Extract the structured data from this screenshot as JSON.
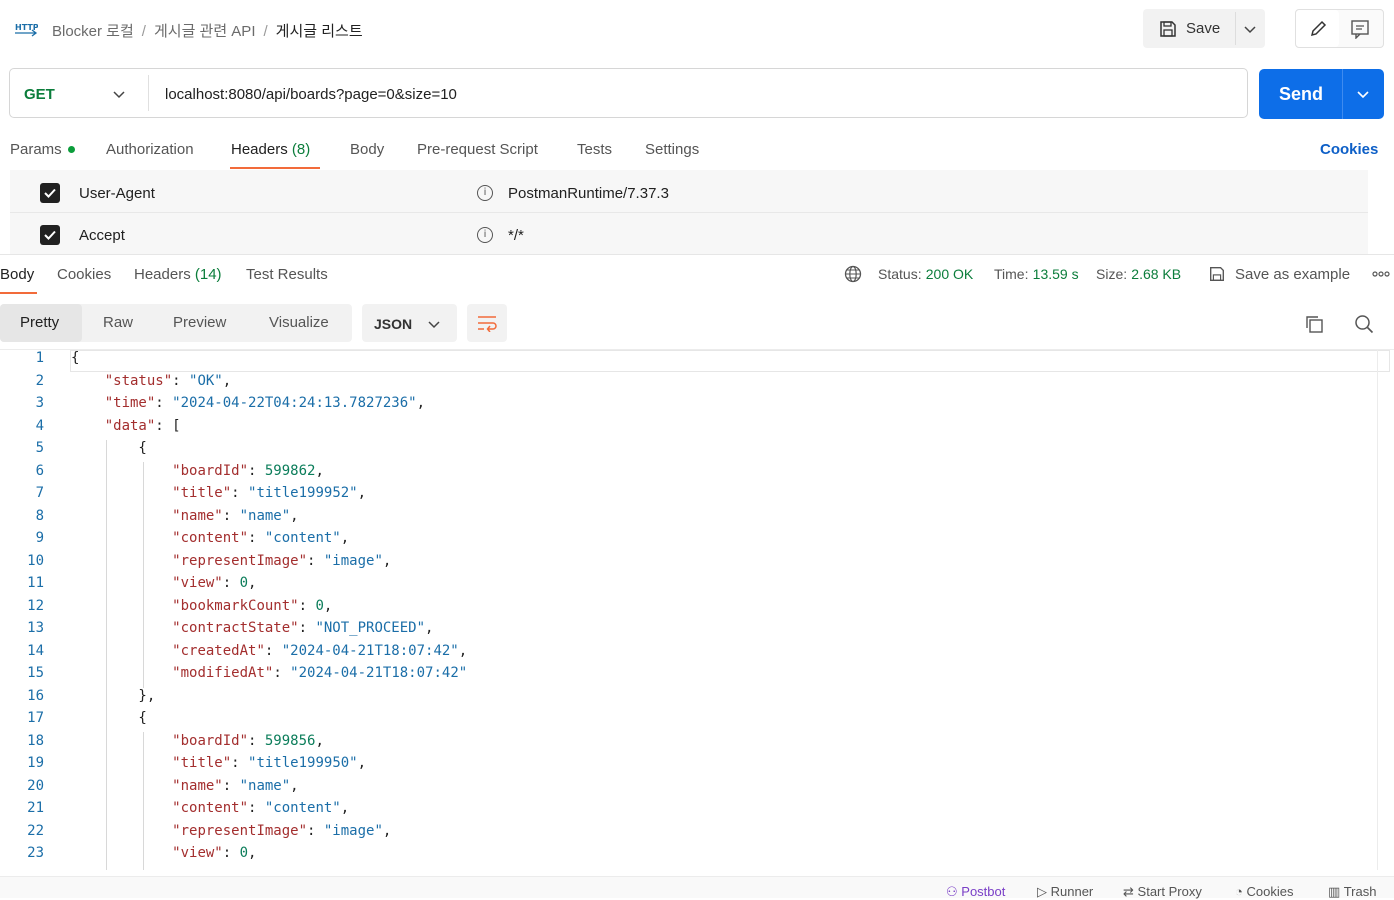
{
  "breadcrumb": {
    "icon": "http-icon",
    "workspace": "Blocker 로컬",
    "folder": "게시글 관련 API",
    "current": "게시글 리스트"
  },
  "header_actions": {
    "save_label": "Save"
  },
  "request": {
    "method": "GET",
    "url": "localhost:8080/api/boards?page=0&size=10",
    "send_label": "Send"
  },
  "request_tabs": {
    "params": "Params",
    "authorization": "Authorization",
    "headers": "Headers",
    "headers_count": "(8)",
    "body": "Body",
    "prerequest": "Pre-request Script",
    "tests": "Tests",
    "settings": "Settings",
    "cookies": "Cookies"
  },
  "headers_rows": [
    {
      "key": "User-Agent",
      "value": "PostmanRuntime/7.37.3"
    },
    {
      "key": "Accept",
      "value": "*/*"
    }
  ],
  "response_tabs": {
    "body": "Body",
    "cookies": "Cookies",
    "headers": "Headers",
    "headers_count": "(14)",
    "test_results": "Test Results"
  },
  "response_meta": {
    "status_label": "Status:",
    "status_value": "200 OK",
    "time_label": "Time:",
    "time_value": "13.59 s",
    "size_label": "Size:",
    "size_value": "2.68 KB",
    "save_example": "Save as example"
  },
  "view_modes": {
    "pretty": "Pretty",
    "raw": "Raw",
    "preview": "Preview",
    "visualize": "Visualize",
    "format": "JSON"
  },
  "code": {
    "lines": [
      [
        [
          "p",
          "{"
        ]
      ],
      [
        [
          "p",
          "    "
        ],
        [
          "k",
          "\"status\""
        ],
        [
          "p",
          ": "
        ],
        [
          "s",
          "\"OK\""
        ],
        [
          "p",
          ","
        ]
      ],
      [
        [
          "p",
          "    "
        ],
        [
          "k",
          "\"time\""
        ],
        [
          "p",
          ": "
        ],
        [
          "s",
          "\"2024-04-22T04:24:13.7827236\""
        ],
        [
          "p",
          ","
        ]
      ],
      [
        [
          "p",
          "    "
        ],
        [
          "k",
          "\"data\""
        ],
        [
          "p",
          ": ["
        ]
      ],
      [
        [
          "p",
          "        {"
        ]
      ],
      [
        [
          "p",
          "            "
        ],
        [
          "k",
          "\"boardId\""
        ],
        [
          "p",
          ": "
        ],
        [
          "n",
          "599862"
        ],
        [
          "p",
          ","
        ]
      ],
      [
        [
          "p",
          "            "
        ],
        [
          "k",
          "\"title\""
        ],
        [
          "p",
          ": "
        ],
        [
          "s",
          "\"title199952\""
        ],
        [
          "p",
          ","
        ]
      ],
      [
        [
          "p",
          "            "
        ],
        [
          "k",
          "\"name\""
        ],
        [
          "p",
          ": "
        ],
        [
          "s",
          "\"name\""
        ],
        [
          "p",
          ","
        ]
      ],
      [
        [
          "p",
          "            "
        ],
        [
          "k",
          "\"content\""
        ],
        [
          "p",
          ": "
        ],
        [
          "s",
          "\"content\""
        ],
        [
          "p",
          ","
        ]
      ],
      [
        [
          "p",
          "            "
        ],
        [
          "k",
          "\"representImage\""
        ],
        [
          "p",
          ": "
        ],
        [
          "s",
          "\"image\""
        ],
        [
          "p",
          ","
        ]
      ],
      [
        [
          "p",
          "            "
        ],
        [
          "k",
          "\"view\""
        ],
        [
          "p",
          ": "
        ],
        [
          "n",
          "0"
        ],
        [
          "p",
          ","
        ]
      ],
      [
        [
          "p",
          "            "
        ],
        [
          "k",
          "\"bookmarkCount\""
        ],
        [
          "p",
          ": "
        ],
        [
          "n",
          "0"
        ],
        [
          "p",
          ","
        ]
      ],
      [
        [
          "p",
          "            "
        ],
        [
          "k",
          "\"contractState\""
        ],
        [
          "p",
          ": "
        ],
        [
          "s",
          "\"NOT_PROCEED\""
        ],
        [
          "p",
          ","
        ]
      ],
      [
        [
          "p",
          "            "
        ],
        [
          "k",
          "\"createdAt\""
        ],
        [
          "p",
          ": "
        ],
        [
          "s",
          "\"2024-04-21T18:07:42\""
        ],
        [
          "p",
          ","
        ]
      ],
      [
        [
          "p",
          "            "
        ],
        [
          "k",
          "\"modifiedAt\""
        ],
        [
          "p",
          ": "
        ],
        [
          "s",
          "\"2024-04-21T18:07:42\""
        ]
      ],
      [
        [
          "p",
          "        },"
        ]
      ],
      [
        [
          "p",
          "        {"
        ]
      ],
      [
        [
          "p",
          "            "
        ],
        [
          "k",
          "\"boardId\""
        ],
        [
          "p",
          ": "
        ],
        [
          "n",
          "599856"
        ],
        [
          "p",
          ","
        ]
      ],
      [
        [
          "p",
          "            "
        ],
        [
          "k",
          "\"title\""
        ],
        [
          "p",
          ": "
        ],
        [
          "s",
          "\"title199950\""
        ],
        [
          "p",
          ","
        ]
      ],
      [
        [
          "p",
          "            "
        ],
        [
          "k",
          "\"name\""
        ],
        [
          "p",
          ": "
        ],
        [
          "s",
          "\"name\""
        ],
        [
          "p",
          ","
        ]
      ],
      [
        [
          "p",
          "            "
        ],
        [
          "k",
          "\"content\""
        ],
        [
          "p",
          ": "
        ],
        [
          "s",
          "\"content\""
        ],
        [
          "p",
          ","
        ]
      ],
      [
        [
          "p",
          "            "
        ],
        [
          "k",
          "\"representImage\""
        ],
        [
          "p",
          ": "
        ],
        [
          "s",
          "\"image\""
        ],
        [
          "p",
          ","
        ]
      ],
      [
        [
          "p",
          "            "
        ],
        [
          "k",
          "\"view\""
        ],
        [
          "p",
          ": "
        ],
        [
          "n",
          "0"
        ],
        [
          "p",
          ","
        ]
      ]
    ]
  },
  "footer": {
    "postbot": "Postbot",
    "runner": "Runner",
    "start_proxy": "Start Proxy",
    "cookies": "Cookies",
    "trash": "Trash"
  },
  "colors": {
    "accent": "#f26b3a",
    "send": "#0d6ee8",
    "success": "#0b7d3b",
    "key": "#a32e2e",
    "string": "#1b6ea8"
  }
}
